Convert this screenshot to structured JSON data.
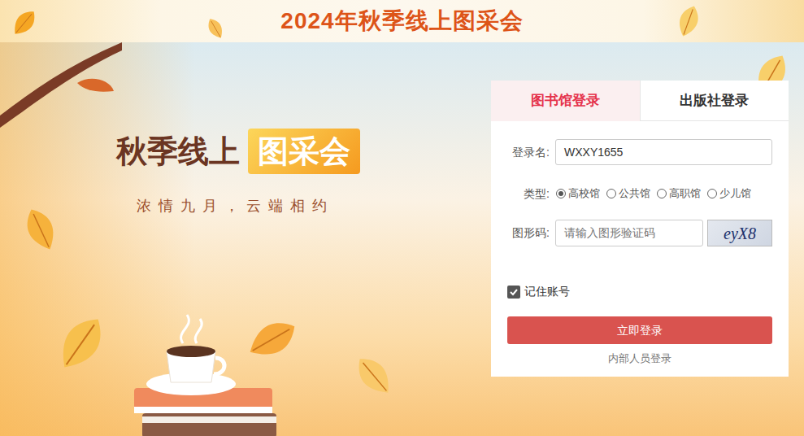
{
  "banner": {
    "title": "2024年秋季线上图采会"
  },
  "hero": {
    "title": "秋季线上",
    "badge": "图采会",
    "subtitle": "浓情九月，云端相约"
  },
  "login": {
    "tabs": [
      {
        "label": "图书馆登录",
        "selected": true
      },
      {
        "label": "出版社登录",
        "selected": false
      }
    ],
    "username": {
      "label": "登录名:",
      "value": "WXXY1655"
    },
    "type": {
      "label": "类型:",
      "options": [
        {
          "label": "高校馆",
          "selected": true
        },
        {
          "label": "公共馆",
          "selected": false
        },
        {
          "label": "高职馆",
          "selected": false
        },
        {
          "label": "少儿馆",
          "selected": false
        }
      ]
    },
    "captcha": {
      "label": "图形码:",
      "placeholder": "请输入图形验证码",
      "image_text": "eyX8"
    },
    "remember": {
      "label": "记住账号",
      "checked": true
    },
    "submit": "立即登录",
    "staff_link": "内部人员登录"
  }
}
